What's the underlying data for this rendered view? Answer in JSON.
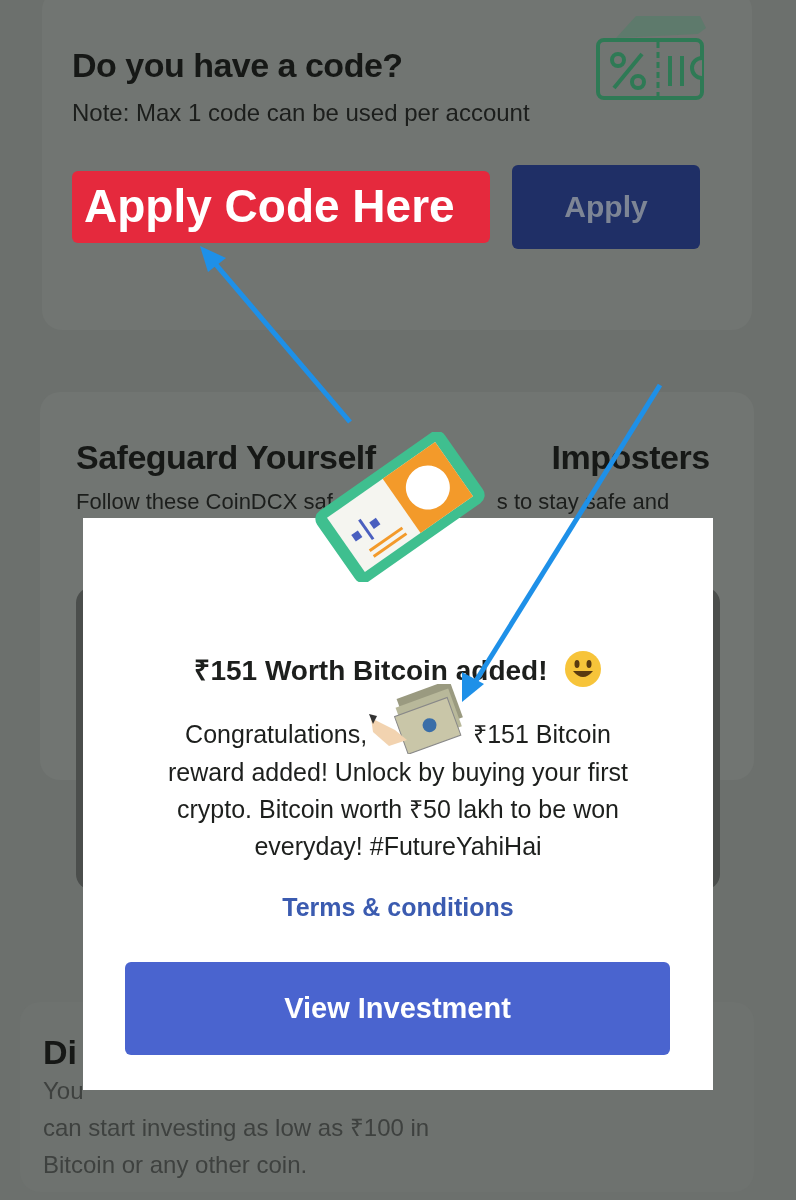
{
  "code_card": {
    "title": "Do you have a code?",
    "note": "Note: Max 1 code can be used per account",
    "code_label": "Apply Code Here",
    "apply_button": {
      "label": "Apply",
      "disabled": true
    }
  },
  "safeguard_card": {
    "title_parts": [
      "Safeguard Yourself",
      "Imposters"
    ],
    "text_parts": [
      "Follow these CoinDCX saf",
      "s to stay safe and"
    ]
  },
  "info_card": {
    "title": "Di",
    "lines": [
      "You",
      "can start investing as low as ₹100 in",
      "Bitcoin or any other coin."
    ]
  },
  "modal": {
    "title": "₹151 Worth Bitcoin added!",
    "body_before": "Congratulations,",
    "body_after": "₹151 Bitcoin",
    "body_rest": "reward added! Unlock by buying your first crypto. Bitcoin worth ₹50 lakh to be won everyday! #FutureYahiHai",
    "terms_link": "Terms & conditions",
    "button": "View Investment"
  }
}
